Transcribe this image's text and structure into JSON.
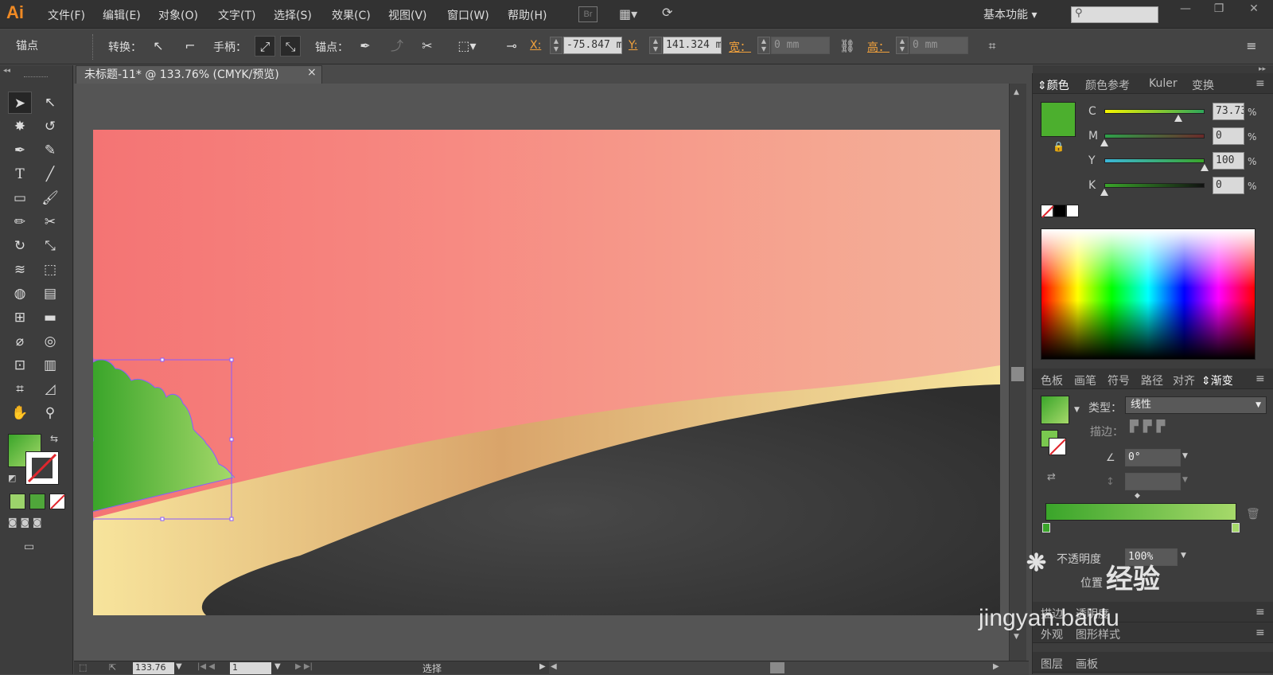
{
  "app": {
    "logo": "Ai",
    "bridge": "Br",
    "workspace": "基本功能",
    "search_placeholder": ""
  },
  "menu": [
    "文件(F)",
    "编辑(E)",
    "对象(O)",
    "文字(T)",
    "选择(S)",
    "效果(C)",
    "视图(V)",
    "窗口(W)",
    "帮助(H)"
  ],
  "control": {
    "mode": "锚点",
    "convert_label": "转换：",
    "handle_label": "手柄：",
    "anchor_label": "锚点：",
    "x_label": "X:",
    "x_value": "-75.847 m",
    "y_label": "Y:",
    "y_value": "141.324 m",
    "w_label": "宽：",
    "w_value": "0 mm",
    "h_label": "高：",
    "h_value": "0 mm"
  },
  "document": {
    "tab_title": "未标题-11* @ 133.76% (CMYK/预览)",
    "close": "×"
  },
  "status": {
    "zoom": "133.76",
    "page": "1",
    "tool": "选择"
  },
  "color_panel": {
    "tabs": [
      "颜色",
      "颜色参考",
      "Kuler",
      "变换"
    ],
    "channels": [
      {
        "name": "C",
        "value": "73.73",
        "fraction": 0.7373
      },
      {
        "name": "M",
        "value": "0",
        "fraction": 0
      },
      {
        "name": "Y",
        "value": "100",
        "fraction": 1
      },
      {
        "name": "K",
        "value": "0",
        "fraction": 0
      }
    ],
    "percent": "%",
    "fill_color": "#4caf2e"
  },
  "gradient_panel": {
    "tabs": [
      "色板",
      "画笔",
      "符号",
      "路径",
      "对齐",
      "渐变"
    ],
    "type_label": "类型：",
    "type_value": "线性",
    "stroke_label": "描边：",
    "angle_value": "0°",
    "opacity_label": "不透明度",
    "opacity_value": "100%",
    "location_label": "位置",
    "start_color": "#3aa52a",
    "end_color": "#a6d96a"
  },
  "bottom_tabs": {
    "row1": [
      "描边",
      "透明度"
    ],
    "row2": [
      "外观",
      "图形样式"
    ],
    "row3": [
      "图层",
      "画板"
    ]
  },
  "watermark": {
    "brand": "经验",
    "url": "jingyan.baidu"
  },
  "artwork": {
    "sky_start": "#f47474",
    "sky_end": "#f3b29b",
    "sand_color": "#f7e49c",
    "sand_mid": "#d9a46a",
    "hill_color": "#3a3a3a",
    "bush_start": "#3aa52a",
    "bush_end": "#a6d96a"
  }
}
